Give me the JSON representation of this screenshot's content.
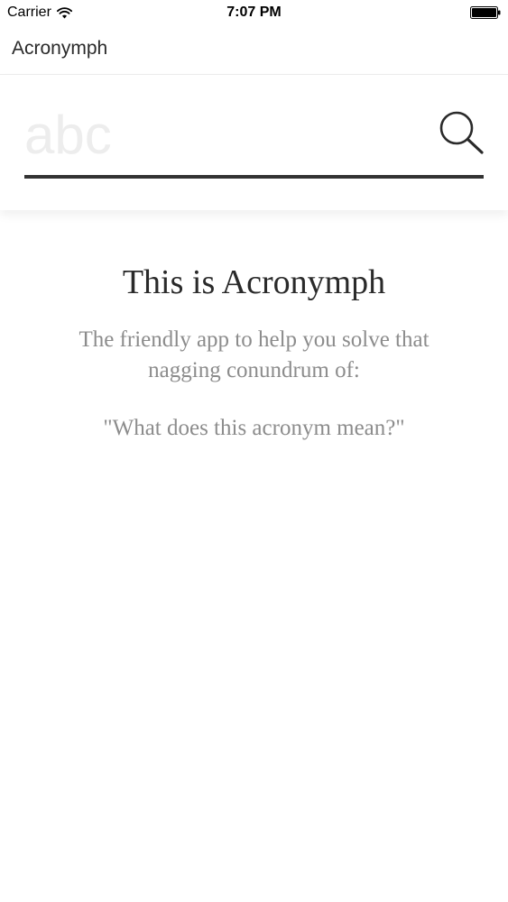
{
  "status_bar": {
    "carrier": "Carrier",
    "time": "7:07 PM",
    "wifi_icon": "wifi-icon",
    "battery_icon": "battery-icon"
  },
  "nav": {
    "title": "Acronymph"
  },
  "search": {
    "value": "",
    "placeholder": "abc",
    "button_icon": "search-icon"
  },
  "intro": {
    "title": "This is Acronymph",
    "subtitle": "The friendly app to help you solve that nagging conundrum of:",
    "question": "\"What does this acronym mean?\""
  },
  "colors": {
    "text_dark": "#2a2a2a",
    "text_muted": "#8c8c8c",
    "underline": "#333333",
    "placeholder": "#ededed",
    "background": "#ffffff"
  }
}
